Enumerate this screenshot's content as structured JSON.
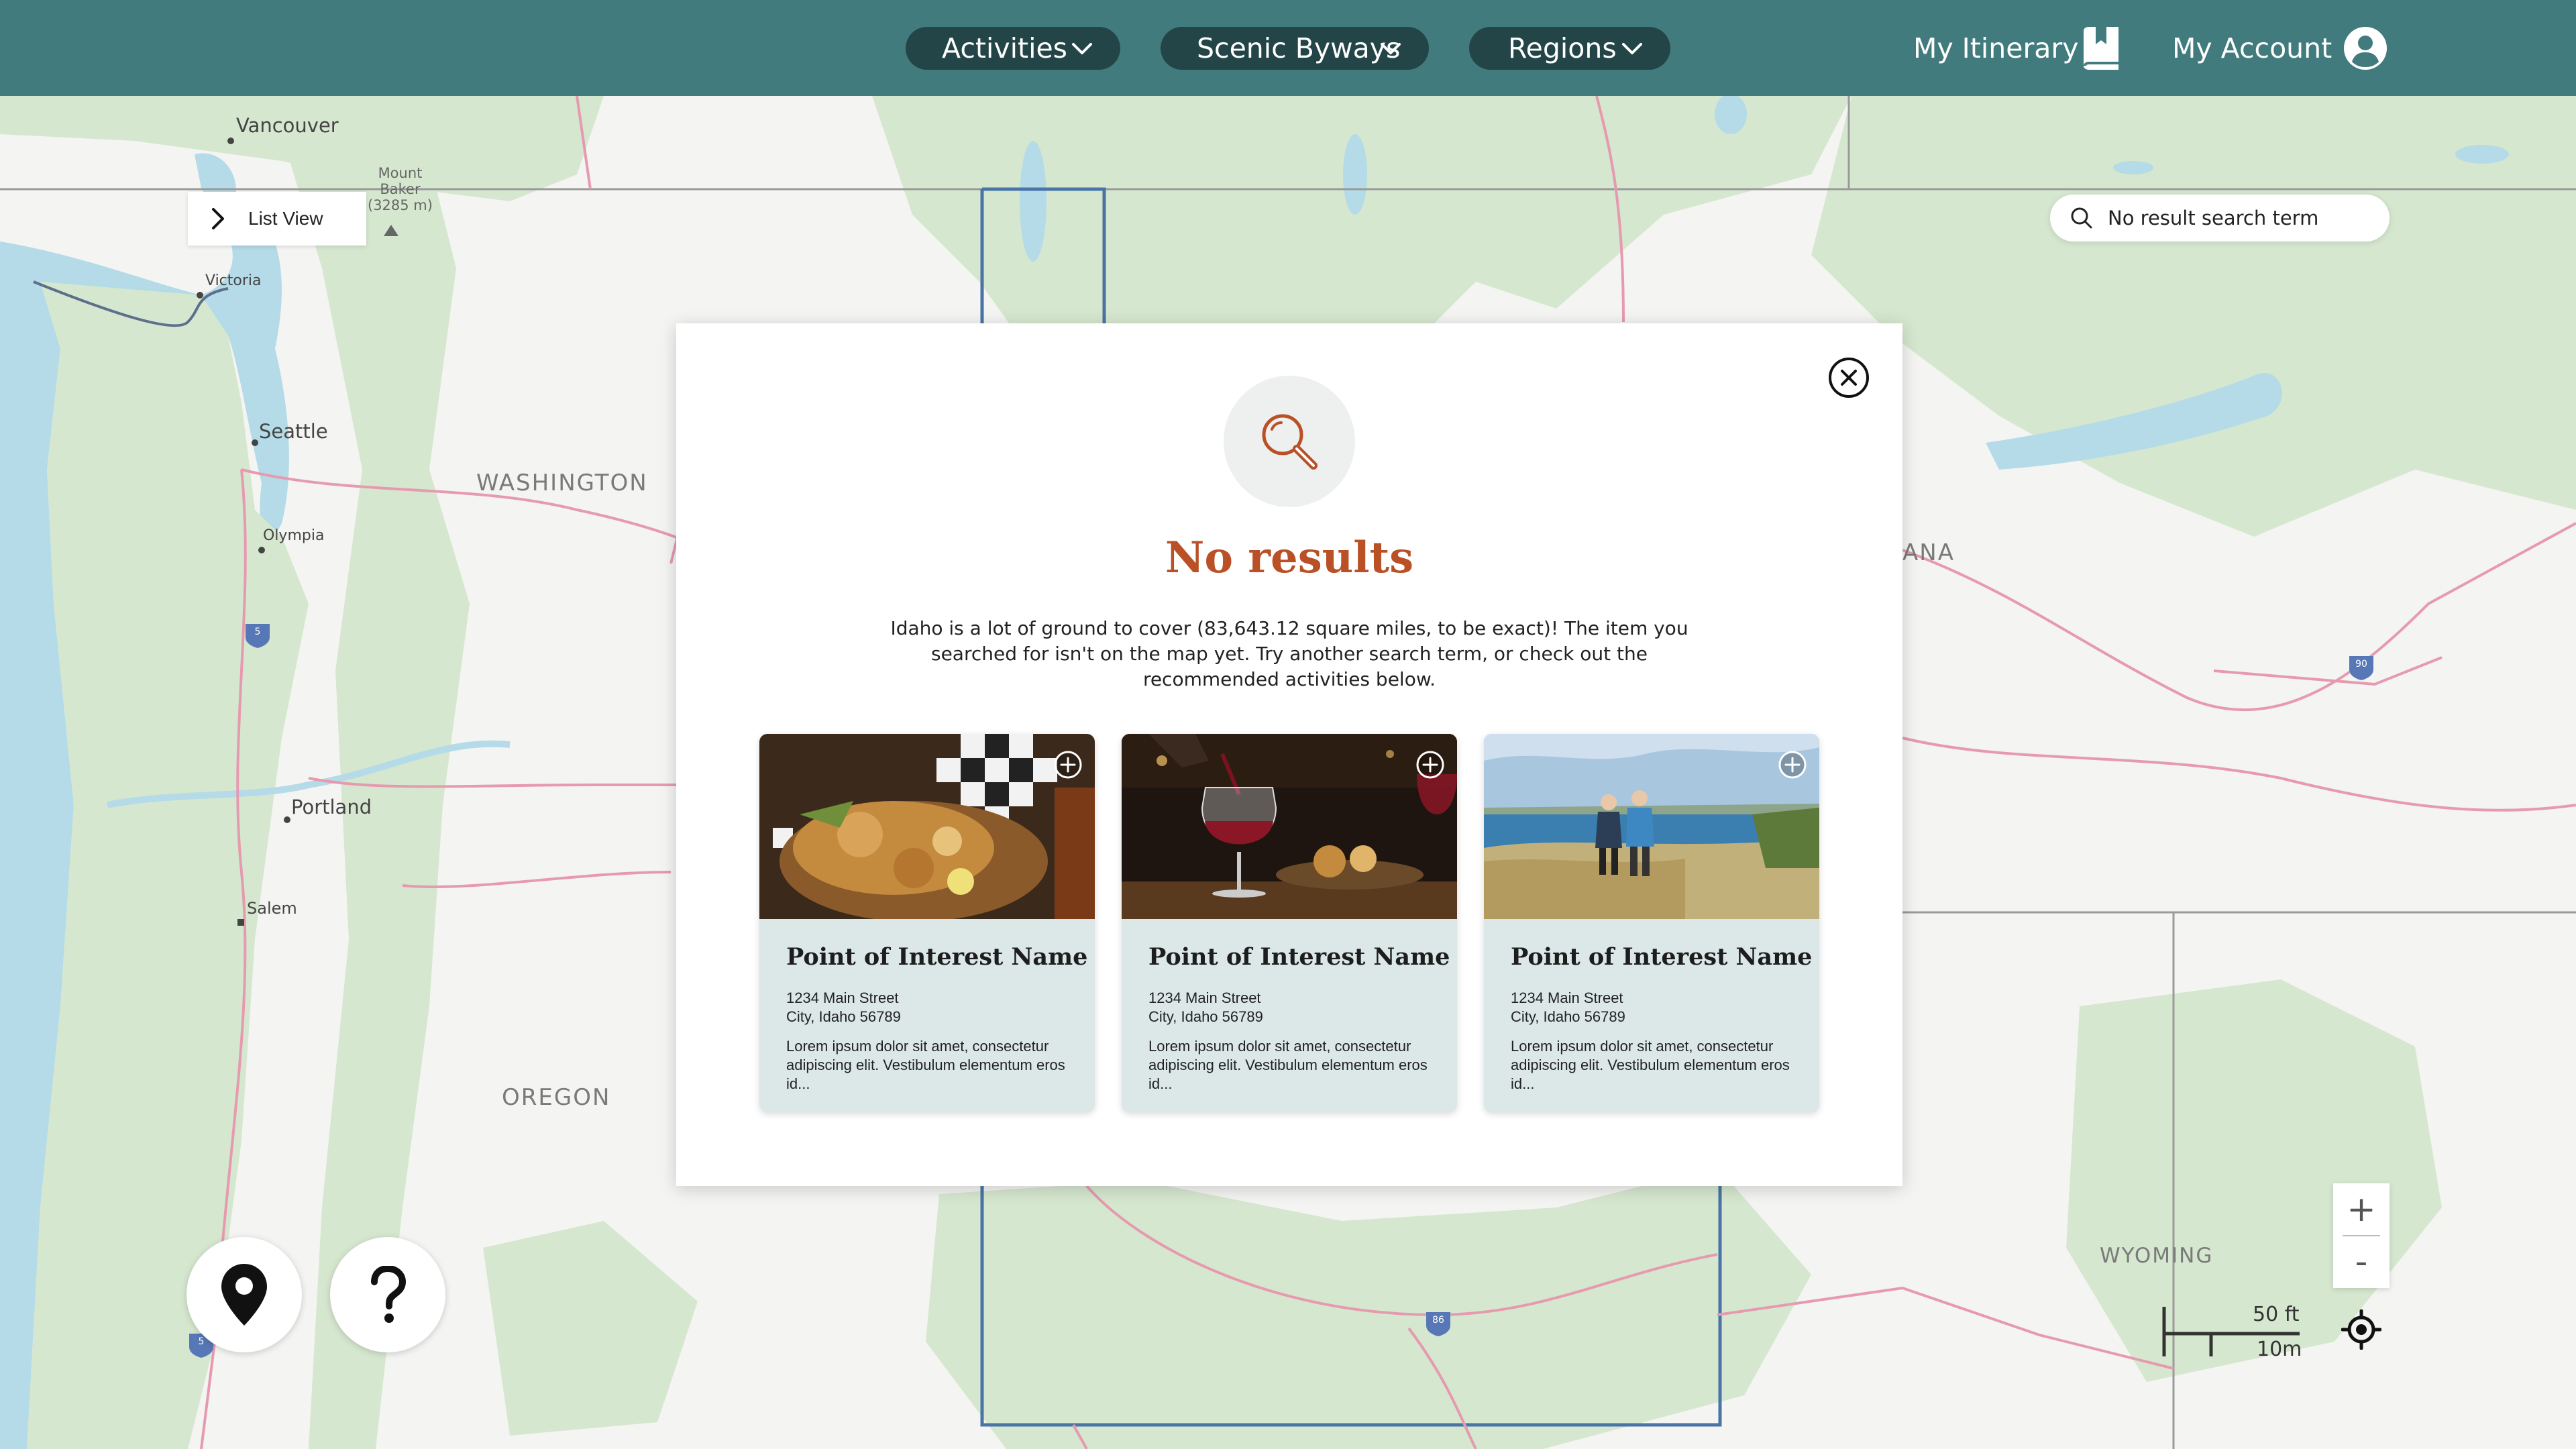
{
  "nav": {
    "activities": "Activities",
    "scenic_byways": "Scenic Byways",
    "regions": "Regions",
    "my_itinerary": "My Itinerary",
    "my_account": "My Account"
  },
  "list_view": {
    "label": "List View"
  },
  "search": {
    "value": "No result search term"
  },
  "modal": {
    "title": "No results",
    "body": "Idaho is a lot of ground to cover (83,643.12 square miles, to be exact)! The item you searched for isn't on the map yet. Try another search term, or check out the recommended activities below."
  },
  "cards": [
    {
      "name": "Point of Interest Name",
      "street": "1234 Main Street",
      "city": "City, Idaho 56789",
      "description": "Lorem ipsum dolor sit amet, consectetur adipiscing elit. Vestibulum elementum eros id..."
    },
    {
      "name": "Point of Interest Name",
      "street": "1234 Main Street",
      "city": "City, Idaho 56789",
      "description": "Lorem ipsum dolor sit amet, consectetur adipiscing elit. Vestibulum elementum eros id..."
    },
    {
      "name": "Point of Interest Name",
      "street": "1234 Main Street",
      "city": "City, Idaho 56789",
      "description": "Lorem ipsum dolor sit amet, consectetur adipiscing elit. Vestibulum elementum eros id..."
    }
  ],
  "map": {
    "states": {
      "washington": "WASHINGTON",
      "oregon": "OREGON",
      "montana": "ANA",
      "wyoming": "WYOMING"
    },
    "cities": {
      "vancouver": "Vancouver",
      "victoria": "Victoria",
      "seattle": "Seattle",
      "olympia": "Olympia",
      "portland": "Portland",
      "salem": "Salem"
    },
    "mount_baker": {
      "name1": "Mount",
      "name2": "Baker",
      "elevation": "(3285 m)"
    },
    "shields": {
      "i5_north": "5",
      "i5_south": "5",
      "i90": "90",
      "i84": "86"
    }
  },
  "controls": {
    "zoom_in": "+",
    "zoom_out": "-",
    "scale_imperial": "50 ft",
    "scale_metric": "10m"
  },
  "icons": {
    "chevron": "chevron-down-icon",
    "itinerary": "book-bookmark-icon",
    "account": "user-circle-icon",
    "list_view": "chevron-right-icon",
    "search": "search-icon",
    "close": "close-icon",
    "magnifier": "magnifier-icon",
    "add": "plus-circle-icon",
    "map_pin": "map-pin-icon",
    "help": "question-icon",
    "locate": "crosshair-icon"
  },
  "colors": {
    "header_bg": "#427b7d",
    "nav_pill_bg": "#234547",
    "title_accent": "#b95026",
    "card_bg": "#dbe8e7",
    "water": "#b4dbe7",
    "forest": "#d6e7cf",
    "state_border": "#e69ab0",
    "idaho_outline": "#4a74a6"
  }
}
